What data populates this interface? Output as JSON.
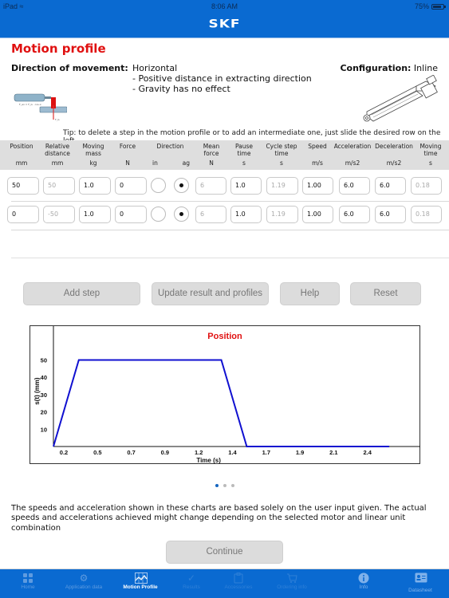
{
  "status_bar": {
    "device": "iPad",
    "time": "8:06 AM",
    "battery": "75%"
  },
  "header": {
    "brand": "SKF"
  },
  "page": {
    "title": "Motion profile",
    "direction_label": "Direction of movement:",
    "direction_lines": [
      "Horizontal",
      "- Positive distance in extracting direction",
      "- Gravity has no effect"
    ],
    "configuration_label": "Configuration:",
    "configuration_value": "Inline",
    "tip": "Tip: to delete a step in the motion profile or to add an intermediate one, just slide the desired row on the left"
  },
  "table": {
    "columns": [
      {
        "name": "Position",
        "unit": "mm"
      },
      {
        "name": "Relative distance",
        "unit": "mm"
      },
      {
        "name": "Moving mass",
        "unit": "kg"
      },
      {
        "name": "Force",
        "unit": "N"
      },
      {
        "name": "Direction",
        "unit_in": "in",
        "unit_ag": "ag"
      },
      {
        "name": "Mean force",
        "unit": "N"
      },
      {
        "name": "Pause time",
        "unit": "s"
      },
      {
        "name": "Cycle step time",
        "unit": "s"
      },
      {
        "name": "Speed",
        "unit": "m/s"
      },
      {
        "name": "Acceleration",
        "unit": "m/s2"
      },
      {
        "name": "Deceleration",
        "unit": "m/s2"
      },
      {
        "name": "Moving time",
        "unit": "s"
      }
    ],
    "rows": [
      {
        "position": "50",
        "relative_distance": "50",
        "moving_mass": "1.0",
        "force": "0",
        "direction": "ag",
        "mean_force": "6",
        "pause_time": "1.0",
        "cycle_step_time": "1.19",
        "speed": "1.00",
        "acceleration": "6.0",
        "deceleration": "6.0",
        "moving_time": "0.18"
      },
      {
        "position": "0",
        "relative_distance": "-50",
        "moving_mass": "1.0",
        "force": "0",
        "direction": "ag",
        "mean_force": "6",
        "pause_time": "1.0",
        "cycle_step_time": "1.19",
        "speed": "1.00",
        "acceleration": "6.0",
        "deceleration": "6.0",
        "moving_time": "0.18"
      }
    ]
  },
  "buttons": {
    "add_step": "Add step",
    "update": "Update result and profiles",
    "help": "Help",
    "reset": "Reset",
    "continue": "Continue"
  },
  "chart_data": {
    "type": "line",
    "title": "Position",
    "xlabel": "Time (s)",
    "ylabel": "s(t) (mm)",
    "x_tick_labels": [
      "0.2",
      "0.5",
      "0.7",
      "0.9",
      "1.2",
      "1.4",
      "1.7",
      "1.9",
      "2.1",
      "2.4"
    ],
    "y_ticks": [
      10,
      20,
      30,
      40,
      50
    ],
    "xlim": [
      0,
      2.6
    ],
    "ylim": [
      0,
      65
    ],
    "grid": false,
    "series": [
      {
        "name": "Position",
        "color": "#1010d0",
        "x": [
          0,
          0.18,
          1.19,
          1.37,
          2.38
        ],
        "y": [
          0,
          50,
          50,
          0,
          0
        ]
      }
    ]
  },
  "pager": {
    "count": 3,
    "active": 0
  },
  "disclaimer": "The speeds and acceleration shown in these charts are based solely on the user input given. The actual speeds and accelerations achieved might change depending on the selected motor and linear unit combination",
  "tabbar": {
    "items": [
      {
        "label": "Home",
        "icon": "grid-icon",
        "state": "dim"
      },
      {
        "label": "Application data",
        "icon": "gear-icon",
        "state": "dim"
      },
      {
        "label": "Motion Profile",
        "icon": "chart-icon",
        "state": "active"
      },
      {
        "label": "Results",
        "icon": "checkmark-icon",
        "state": "faint"
      },
      {
        "label": "Accessories",
        "icon": "clipboard-icon",
        "state": "faint"
      },
      {
        "label": "Ordering info",
        "icon": "cart-icon",
        "state": "faint"
      },
      {
        "label": "Info",
        "icon": "info-icon",
        "state": "mid"
      },
      {
        "label": "Datasheet",
        "icon": "id-card-icon",
        "state": "mid"
      }
    ]
  },
  "colors": {
    "brand_blue": "#0A6AD1",
    "title_red": "#e01010",
    "line_blue": "#1010d0"
  }
}
